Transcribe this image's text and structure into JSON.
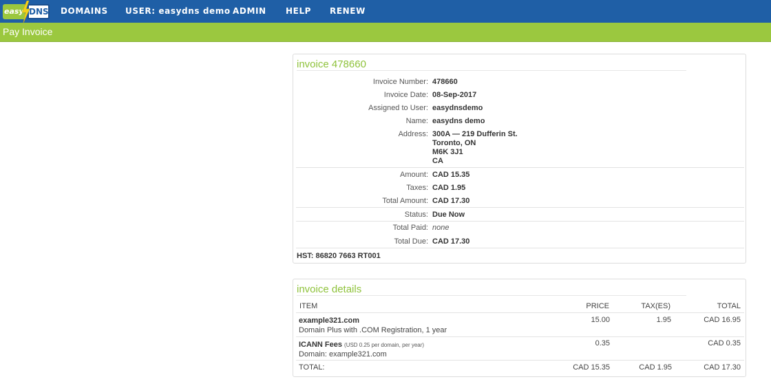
{
  "header": {
    "logo_easy": "easy",
    "logo_dns": "DNS",
    "nav": [
      "DOMAINS",
      "USER: easydns demo",
      "ADMIN",
      "HELP",
      "RENEW"
    ]
  },
  "subheader": {
    "title": "Pay Invoice"
  },
  "invoice": {
    "title": "invoice 478660",
    "fields": {
      "number_label": "Invoice Number:",
      "number": "478660",
      "date_label": "Invoice Date:",
      "date": "08-Sep-2017",
      "user_label": "Assigned to User:",
      "user": "easydnsdemo",
      "name_label": "Name:",
      "name": "easydns demo",
      "address_label": "Address:",
      "address_lines": [
        "300A — 219 Dufferin St.",
        "Toronto, ON",
        "M6K 3J1",
        "CA"
      ],
      "amount_label": "Amount:",
      "amount": "CAD 15.35",
      "taxes_label": "Taxes:",
      "taxes": "CAD 1.95",
      "total_label": "Total Amount:",
      "total": "CAD 17.30",
      "status_label": "Status:",
      "status": "Due Now",
      "paid_label": "Total Paid:",
      "paid": "none",
      "due_label": "Total Due:",
      "due": "CAD 17.30"
    },
    "hst": "HST: 86820 7663 RT001"
  },
  "details": {
    "title": "invoice details",
    "columns": [
      "ITEM",
      "PRICE",
      "TAX(ES)",
      "TOTAL"
    ],
    "rows": [
      {
        "item": "example321.com",
        "desc": "Domain Plus with .COM Registration, 1 year",
        "note": "",
        "price": "15.00",
        "tax": "1.95",
        "total": "CAD 16.95"
      },
      {
        "item": "ICANN Fees",
        "note": "(USD 0.25 per domain, per year)",
        "desc": "Domain: example321.com",
        "price": "0.35",
        "tax": "",
        "total": "CAD 0.35"
      }
    ],
    "totals": {
      "label": "TOTAL:",
      "price": "CAD 15.35",
      "tax": "CAD 1.95",
      "total": "CAD 17.30"
    }
  },
  "colors": {
    "nav_blue": "#1f5fa6",
    "accent_green": "#9bc83f",
    "title_green": "#8ec23a"
  },
  "icons": [
    "lightning-bolt-icon"
  ]
}
